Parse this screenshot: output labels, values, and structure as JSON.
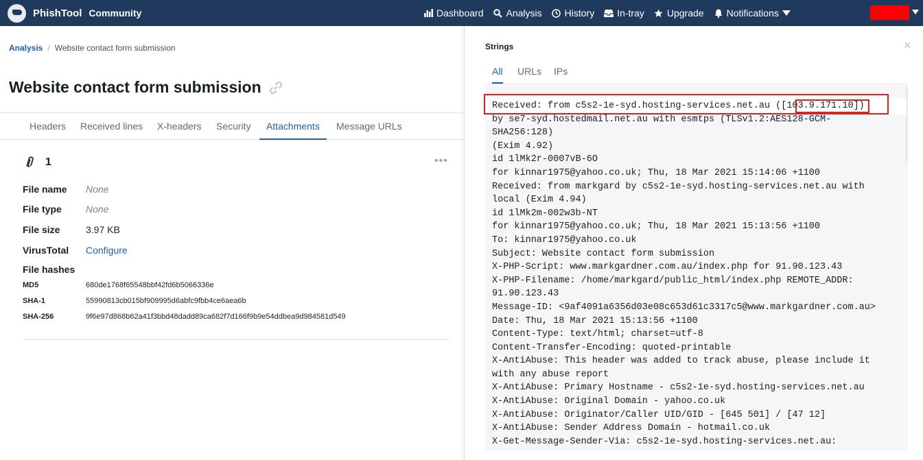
{
  "navbar": {
    "brand": "PhishTool",
    "edition": "Community",
    "links": [
      {
        "label": "Dashboard",
        "icon": "bar-chart-icon"
      },
      {
        "label": "Analysis",
        "icon": "search-icon"
      },
      {
        "label": "History",
        "icon": "clock-icon"
      },
      {
        "label": "In-tray",
        "icon": "inbox-icon"
      },
      {
        "label": "Upgrade",
        "icon": "star-icon"
      },
      {
        "label": "Notifications",
        "icon": "bell-icon"
      }
    ],
    "accent_color": "#1f3a5c",
    "redaction_color": "#ff0000"
  },
  "breadcrumb": {
    "parent": "Analysis",
    "current": "Website contact form submission"
  },
  "page": {
    "title": "Website contact form submission",
    "tabs": [
      "Headers",
      "Received lines",
      "X-headers",
      "Security",
      "Attachments",
      "Message URLs"
    ],
    "active_tab": "Attachments"
  },
  "attachment": {
    "count": "1",
    "fields": {
      "file_name_label": "File name",
      "file_name": "None",
      "file_type_label": "File type",
      "file_type": "None",
      "file_size_label": "File size",
      "file_size": "3.97 KB",
      "virustotal_label": "VirusTotal",
      "virustotal": "Configure",
      "hashes_label": "File hashes"
    },
    "hashes": [
      {
        "label": "MD5",
        "value": "680de1768f65548bbf42fd6b5066336e"
      },
      {
        "label": "SHA-1",
        "value": "55990813cb015bf909995d6abfc9fbb4ce6aea6b"
      },
      {
        "label": "SHA-256",
        "value": "9f6e97d868b62a41f3bbd48dadd89ca682f7d166f9b9e54ddbea9d984581d549"
      }
    ]
  },
  "strings_panel": {
    "title": "Strings",
    "tabs": [
      "All",
      "URLs",
      "IPs"
    ],
    "active_tab": "All",
    "lines": [
      "Received: from c5s2-1e-syd.hosting-services.net.au ([103.9.171.10])",
      "by se7-syd.hostedmail.net.au with esmtps (TLSv1.2:AES128-GCM-",
      "SHA256:128)",
      "(Exim 4.92)",
      "id 1lMk2r-0007vB-6O",
      "for kinnar1975@yahoo.co.uk; Thu, 18 Mar 2021 15:14:06 +1100",
      "Received: from markgard by c5s2-1e-syd.hosting-services.net.au with",
      "local (Exim 4.94)",
      "id 1lMk2m-002w3b-NT",
      "for kinnar1975@yahoo.co.uk; Thu, 18 Mar 2021 15:13:56 +1100",
      "To: kinnar1975@yahoo.co.uk",
      "Subject: Website contact form submission",
      "X-PHP-Script: www.markgardner.com.au/index.php for 91.90.123.43",
      "X-PHP-Filename: /home/markgard/public_html/index.php REMOTE_ADDR:",
      "91.90.123.43",
      "Message-ID: <9af4091a6356d03e08c653d61c3317c5@www.markgardner.com.au>",
      "Date: Thu, 18 Mar 2021 15:13:56 +1100",
      "Content-Type: text/html; charset=utf-8",
      "Content-Transfer-Encoding: quoted-printable",
      "X-AntiAbuse: This header was added to track abuse, please include it",
      "with any abuse report",
      "X-AntiAbuse: Primary Hostname - c5s2-1e-syd.hosting-services.net.au",
      "X-AntiAbuse: Original Domain - yahoo.co.uk",
      "X-AntiAbuse: Originator/Caller UID/GID - [645 501] / [47 12]",
      "X-AntiAbuse: Sender Address Domain - hotmail.co.uk",
      "X-Get-Message-Sender-Via: c5s2-1e-syd.hosting-services.net.au:"
    ]
  }
}
